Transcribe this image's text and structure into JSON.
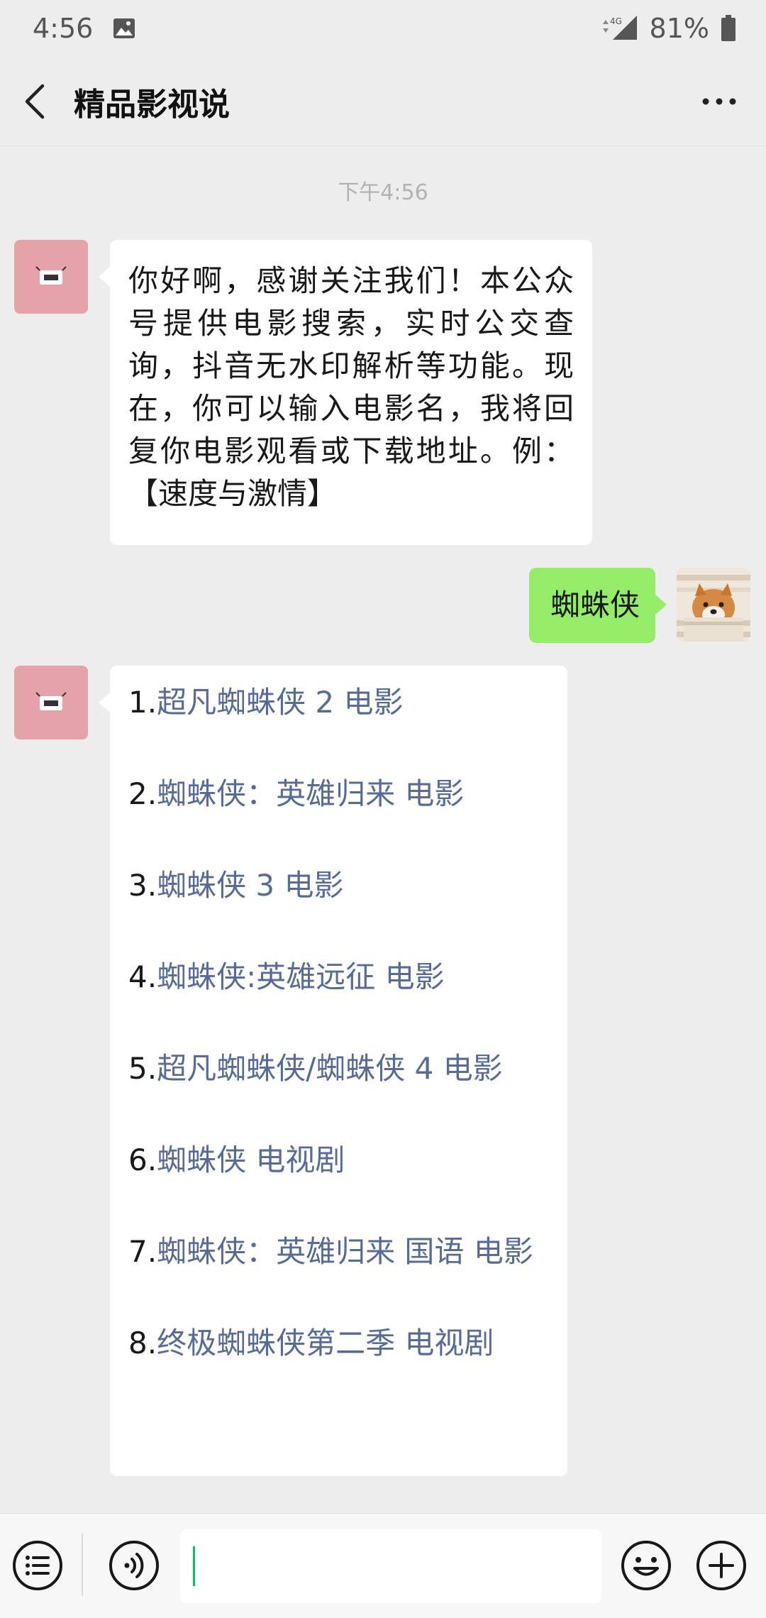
{
  "status_bar": {
    "time": "4:56",
    "network": "4G",
    "battery": "81%",
    "icons": [
      "image-icon",
      "signal-icon",
      "battery-icon"
    ]
  },
  "header": {
    "title": "精品影视说",
    "icons": [
      "back-arrow-icon",
      "more-dots-icon"
    ]
  },
  "chat": {
    "timestamp": "下午4:56",
    "greeting": "你好啊，感谢关注我们！本公众号提供电影搜索，实时公交查询，抖音无水印解析等功能。现在，你可以输入电影名，我将回复你电影观看或下载地址。例：【速度与激情】",
    "sent_message": "蜘蛛侠",
    "results": [
      {
        "num": "1.",
        "title": "超凡蜘蛛侠 2 电影"
      },
      {
        "num": "2.",
        "title": "蜘蛛侠：英雄归来 电影"
      },
      {
        "num": "3.",
        "title": "蜘蛛侠 3 电影"
      },
      {
        "num": "4.",
        "title": "蜘蛛侠:英雄远征 电影"
      },
      {
        "num": "5.",
        "title": "超凡蜘蛛侠/蜘蛛侠 4 电影"
      },
      {
        "num": "6.",
        "title": "蜘蛛侠 电视剧"
      },
      {
        "num": "7.",
        "title": "蜘蛛侠：英雄归来 国语 电影"
      },
      {
        "num": "8.",
        "title": "终极蜘蛛侠第二季 电视剧"
      }
    ]
  },
  "bottom_bar": {
    "icons": [
      "menu-list-icon",
      "voice-icon",
      "emoji-icon",
      "plus-icon"
    ]
  },
  "colors": {
    "background": "#ededed",
    "sent_bubble": "#95ec69",
    "link": "#576b95",
    "cursor": "#07c160"
  }
}
